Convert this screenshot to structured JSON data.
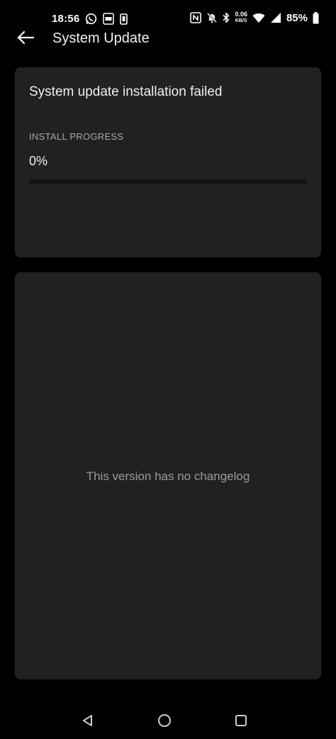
{
  "status_bar": {
    "time": "18:56",
    "left_icons": [
      "whatsapp-icon",
      "ring-icon",
      "phone-outline-icon"
    ],
    "right_icons": [
      "nfc-icon",
      "mute-bell-icon",
      "bluetooth-icon",
      "wifi-icon",
      "signal-icon",
      "battery-icon"
    ],
    "net_speed": "0.06",
    "net_unit": "KB/S",
    "battery_text": "85%",
    "battery_level": 0.85
  },
  "header": {
    "back_icon": "arrow-left-icon",
    "title": "System Update"
  },
  "status_card": {
    "title": "System update installation failed",
    "progress_label": "INSTALL PROGRESS",
    "progress_text": "0%",
    "progress_value": 0
  },
  "changelog": {
    "empty_text": "This version has no changelog"
  },
  "nav_bar": {
    "icons": [
      "triangle-back-icon",
      "circle-home-icon",
      "square-recents-icon"
    ]
  },
  "colors": {
    "background": "#000000",
    "card": "#212121",
    "primary_text": "#f0f0f0",
    "secondary_text": "#a8a8a8",
    "progress_track": "#141414"
  }
}
